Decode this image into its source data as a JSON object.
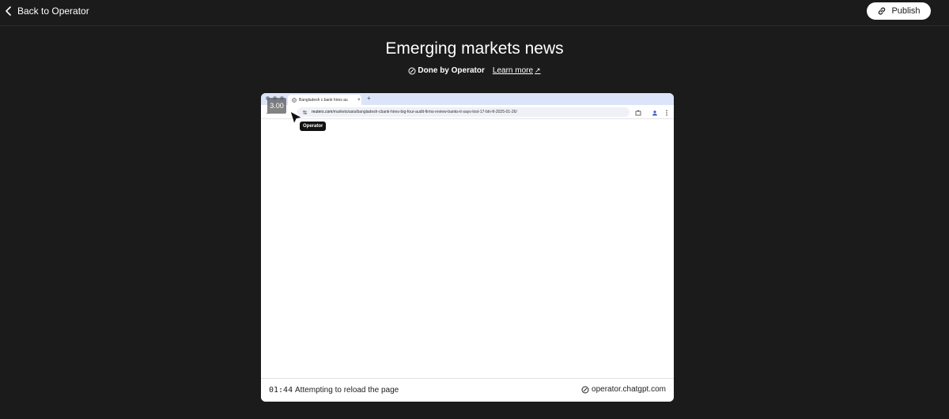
{
  "header": {
    "back_label": "Back to Operator",
    "publish_label": "Publish"
  },
  "page": {
    "title": "Emerging markets news",
    "done_label": "Done by Operator",
    "learn_more_label": "Learn more",
    "learn_more_arrow": "↗"
  },
  "browser": {
    "tab_title": "Bangladesh c.bank hires au",
    "tab_close": "×",
    "new_tab": "+",
    "url_domain": "reuters.com",
    "url_path": "/markets/asia/bangladesh-cbank-hires-big-four-audit-firms-review-banks-it-says-lost-17-bln-ft-2025-01-26/",
    "playback_speed": "3.00",
    "cursor_label": "Operator",
    "nav_back": "←"
  },
  "footer": {
    "timer": "01:44",
    "status": "Attempting to reload the page",
    "domain": "operator.chatgpt.com"
  },
  "colors": {
    "background": "#1b1b1b",
    "tab_strip": "#dbe4f8",
    "url_box": "#eef1f6"
  },
  "icons": [
    "chevron-left-icon",
    "link-icon",
    "operator-logo-icon",
    "external-arrow-icon",
    "globe-icon",
    "tune-icon",
    "extension-icon",
    "profile-icon",
    "kebab-menu-icon",
    "cursor-icon"
  ]
}
